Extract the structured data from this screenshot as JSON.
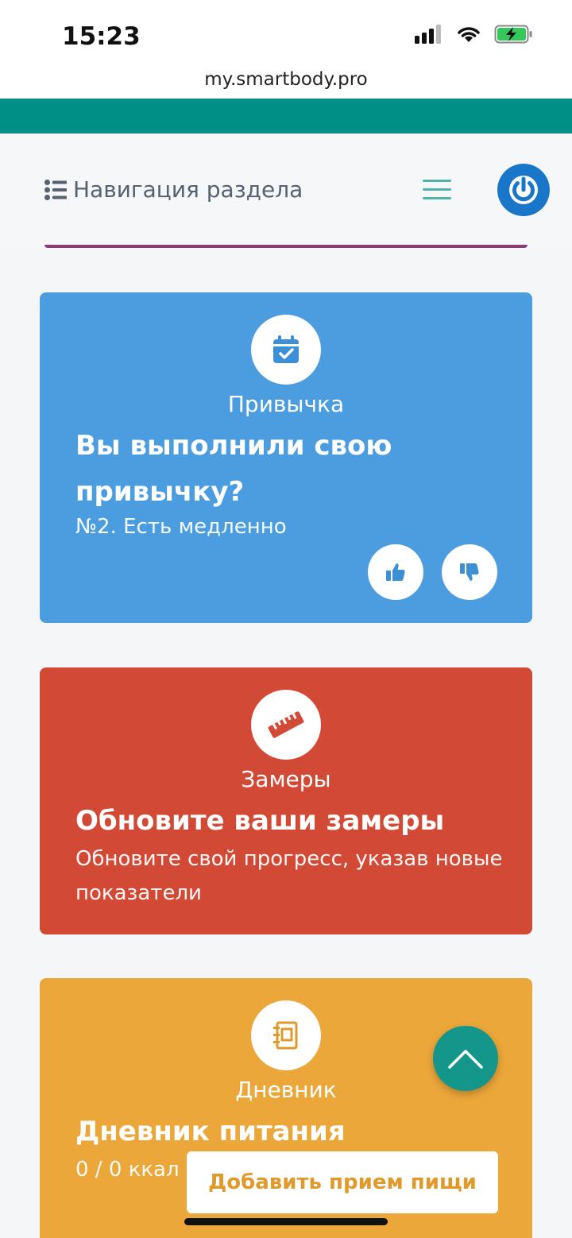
{
  "status_bar": {
    "time": "15:23"
  },
  "browser": {
    "url": "my.smartbody.pro"
  },
  "colors": {
    "teal": "#008f86",
    "habit_card": "#4b9ddf",
    "measure_card": "#d24a36",
    "diary_card": "#eca73a",
    "accent_blue": "#1976c9"
  },
  "navbar": {
    "section_nav_label": "Навигация раздела",
    "section_nav_icon": "list-icon",
    "menu_icon": "hamburger-icon",
    "power_icon": "power-icon"
  },
  "cards": {
    "habit": {
      "icon": "calendar-check-icon",
      "category": "Привычка",
      "title": "Вы выполнили свою привычку?",
      "subtitle": "№2. Есть медленно",
      "like_icon": "thumbs-up-icon",
      "dislike_icon": "thumbs-down-icon"
    },
    "measure": {
      "icon": "ruler-icon",
      "category": "Замеры",
      "title": "Обновите ваши замеры",
      "subtitle": "Обновите свой прогресс, указав новые показатели"
    },
    "diary": {
      "icon": "notebook-icon",
      "category": "Дневник",
      "title": "Дневник питания",
      "calories": "0 / 0 ккал",
      "add_button": "Добавить прием пищи"
    }
  },
  "scroll_top_icon": "chevron-up-icon"
}
